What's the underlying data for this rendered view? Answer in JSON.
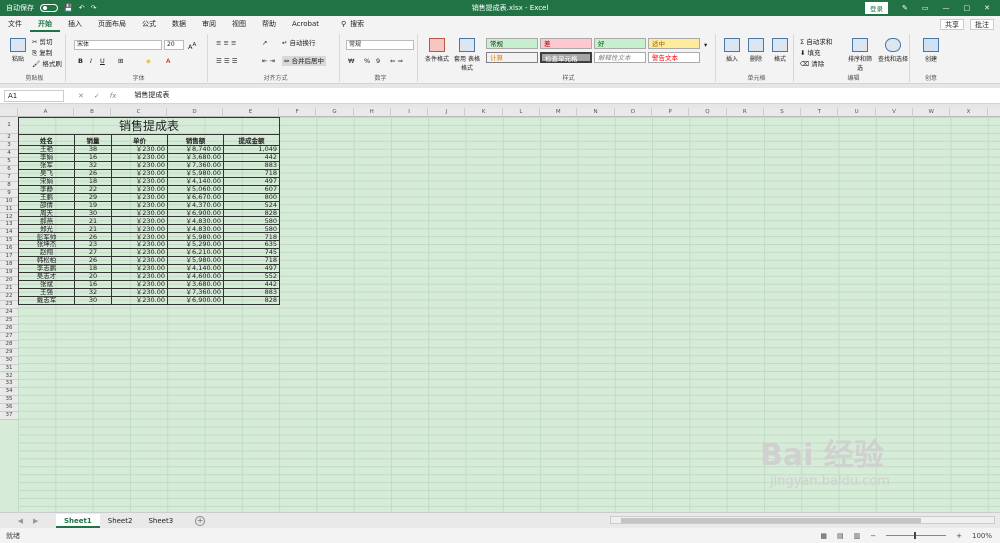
{
  "titlebar": {
    "autosave_label": "自动保存",
    "autosave_state": "关",
    "doc_title": "销售提成表.xlsx - Excel",
    "login": "登录"
  },
  "menu": {
    "tabs": [
      "文件",
      "开始",
      "插入",
      "页面布局",
      "公式",
      "数据",
      "审阅",
      "视图",
      "帮助",
      "Acrobat"
    ],
    "active_tab": "开始",
    "search": "搜索",
    "share": "共享",
    "comments": "批注"
  },
  "ribbon": {
    "clipboard": {
      "paste": "粘贴",
      "cut": "剪切",
      "copy": "复制",
      "format_painter": "格式刷",
      "label": "剪贴板"
    },
    "font": {
      "name": "宋体",
      "size": "20",
      "bold": "B",
      "italic": "I",
      "underline": "U",
      "label": "字体"
    },
    "alignment": {
      "wrap": "自动换行",
      "merge": "合并后居中",
      "label": "对齐方式"
    },
    "number": {
      "format": "常规",
      "percent": "%",
      "comma": "9",
      "label": "数字"
    },
    "styles": {
      "conditional": "条件格式",
      "table_format": "套用\n表格格式",
      "cells": [
        {
          "text": "常规",
          "bg": "#c6efce"
        },
        {
          "text": "差",
          "bg": "#ffc7ce"
        },
        {
          "text": "好",
          "bg": "#c6efce"
        },
        {
          "text": "适中",
          "bg": "#ffeb9c"
        },
        {
          "text": "计算",
          "bg": "#f2f2f2"
        },
        {
          "text": "检查单元格",
          "bg": "#a5a5a5"
        },
        {
          "text": "解释性文本",
          "bg": "#ffffff"
        },
        {
          "text": "警告文本",
          "bg": "#ffffff"
        }
      ],
      "label": "样式"
    },
    "cells_group": {
      "insert": "插入",
      "delete": "删除",
      "format": "格式",
      "label": "单元格"
    },
    "editing": {
      "autosum": "自动求和",
      "fill": "填充",
      "clear": "清除",
      "sort": "排序和筛选",
      "find": "查找和选择",
      "label": "编辑"
    },
    "create": {
      "create": "创建",
      "label": "创意"
    }
  },
  "formula_bar": {
    "name_box": "A1",
    "content": "销售提成表"
  },
  "columns": [
    "A",
    "B",
    "C",
    "D",
    "E",
    "F",
    "G",
    "H",
    "I",
    "J",
    "K",
    "L",
    "M",
    "N",
    "O",
    "P",
    "Q",
    "R",
    "S",
    "T",
    "U",
    "V",
    "W",
    "X",
    "Y"
  ],
  "rows": [
    "1",
    "2",
    "3",
    "4",
    "5",
    "6",
    "7",
    "8",
    "9",
    "10",
    "11",
    "12",
    "13",
    "14",
    "15",
    "16",
    "17",
    "18",
    "19",
    "20",
    "21",
    "22",
    "23",
    "24",
    "25",
    "26",
    "27",
    "28",
    "29",
    "30",
    "31",
    "32",
    "33",
    "34",
    "35",
    "36",
    "37"
  ],
  "table": {
    "title": "销售提成表",
    "headers": [
      "姓名",
      "销量",
      "单价",
      "销售额",
      "提成金额"
    ],
    "rows": [
      [
        "王艳",
        "38",
        "￥230.00",
        "￥8,740.00",
        "1,049"
      ],
      [
        "李娟",
        "16",
        "￥230.00",
        "￥3,680.00",
        "442"
      ],
      [
        "张军",
        "32",
        "￥230.00",
        "￥7,360.00",
        "883"
      ],
      [
        "吴飞",
        "26",
        "￥230.00",
        "￥5,980.00",
        "718"
      ],
      [
        "宋娟",
        "18",
        "￥230.00",
        "￥4,140.00",
        "497"
      ],
      [
        "李静",
        "22",
        "￥230.00",
        "￥5,060.00",
        "607"
      ],
      [
        "王鹏",
        "29",
        "￥230.00",
        "￥6,670.00",
        "800"
      ],
      [
        "邵倩",
        "19",
        "￥230.00",
        "￥4,370.00",
        "524"
      ],
      [
        "周天",
        "30",
        "￥230.00",
        "￥6,900.00",
        "828"
      ],
      [
        "郝燕",
        "21",
        "￥230.00",
        "￥4,830.00",
        "580"
      ],
      [
        "郑光",
        "21",
        "￥230.00",
        "￥4,830.00",
        "580"
      ],
      [
        "彭军帅",
        "26",
        "￥230.00",
        "￥5,980.00",
        "718"
      ],
      [
        "张坤杰",
        "23",
        "￥230.00",
        "￥5,290.00",
        "635"
      ],
      [
        "赵翔",
        "27",
        "￥230.00",
        "￥6,210.00",
        "745"
      ],
      [
        "韩松柏",
        "26",
        "￥230.00",
        "￥5,980.00",
        "718"
      ],
      [
        "李志鹏",
        "18",
        "￥230.00",
        "￥4,140.00",
        "497"
      ],
      [
        "吴志才",
        "20",
        "￥230.00",
        "￥4,600.00",
        "552"
      ],
      [
        "张斌",
        "16",
        "￥230.00",
        "￥3,680.00",
        "442"
      ],
      [
        "王强",
        "32",
        "￥230.00",
        "￥7,360.00",
        "883"
      ],
      [
        "戴志军",
        "30",
        "￥230.00",
        "￥6,900.00",
        "828"
      ]
    ]
  },
  "sheets": [
    "Sheet1",
    "Sheet2",
    "Sheet3"
  ],
  "active_sheet": "Sheet1",
  "status": {
    "ready": "就绪",
    "zoom": "100%"
  },
  "watermark": {
    "logo": "Bai 经验",
    "url": "jingyan.baidu.com"
  },
  "colors": {
    "excel_green": "#217346",
    "sheet_bg": "#d6ebd8"
  }
}
